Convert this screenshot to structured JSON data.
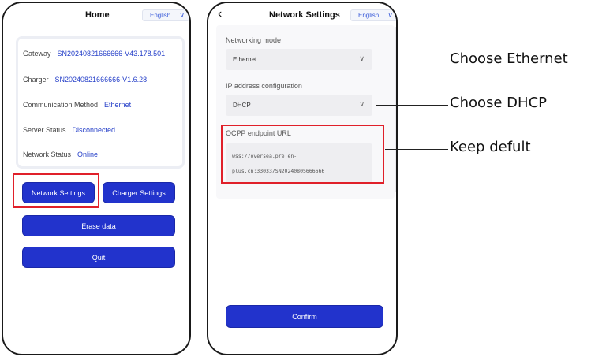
{
  "home": {
    "title": "Home",
    "language": "English",
    "info": [
      {
        "label": "Gateway",
        "value": "SN20240821666666-V43.178.501"
      },
      {
        "label": "Charger",
        "value": "SN20240821666666-V1.6.28"
      },
      {
        "label": "Communication Method",
        "value": "Ethernet"
      },
      {
        "label": "Server Status",
        "value": "Disconnected"
      },
      {
        "label": "Network Status",
        "value": "Online"
      }
    ],
    "network_settings_label": "Network Settings",
    "charger_settings_label": "Charger Settings",
    "erase_label": "Erase data",
    "quit_label": "Quit"
  },
  "network": {
    "title": "Network Settings",
    "language": "English",
    "networking_mode_label": "Networking mode",
    "networking_mode_value": "Ethernet",
    "ip_config_label": "IP address configuration",
    "ip_config_value": "DHCP",
    "ocpp_label": "OCPP endpoint URL",
    "ocpp_line1": "wss://oversea.pre.en-",
    "ocpp_line2": "plus.cn:33033/SN20240805666666",
    "confirm_label": "Confirm"
  },
  "annotations": {
    "ethernet": "Choose Ethernet",
    "dhcp": "Choose DHCP",
    "default": "Keep defult"
  },
  "colors": {
    "accent": "#2233cc",
    "highlight": "#e0202a",
    "link": "#2741c9"
  }
}
